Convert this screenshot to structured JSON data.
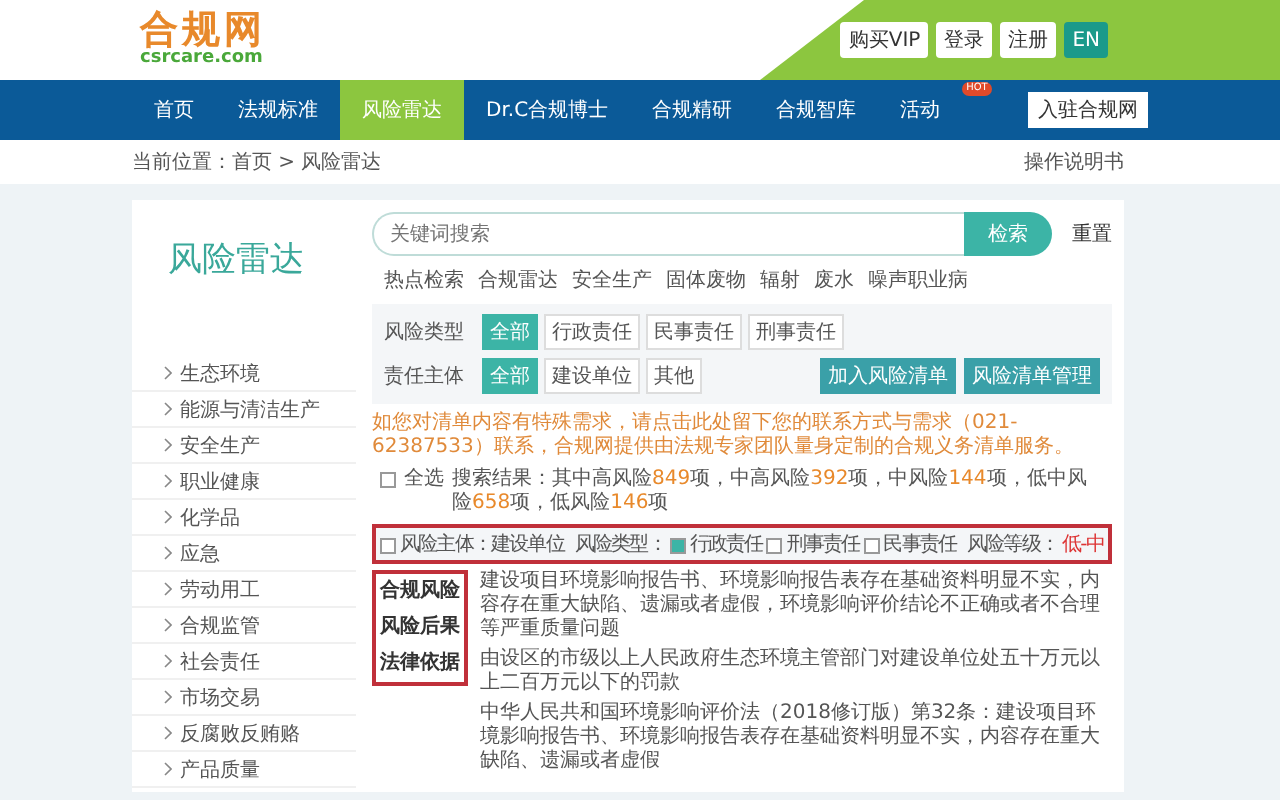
{
  "header": {
    "logo_text": "合规网",
    "logo_domain": "csrcare.com",
    "account_buttons": [
      {
        "label": "购买VIP",
        "kind": "plain"
      },
      {
        "label": "登录",
        "kind": "plain"
      },
      {
        "label": "注册",
        "kind": "plain"
      },
      {
        "label": "EN",
        "kind": "accent"
      }
    ]
  },
  "nav": {
    "items": [
      {
        "label": "首页",
        "selected": false
      },
      {
        "label": "法规标准",
        "selected": false
      },
      {
        "label": "风险雷达",
        "selected": true
      },
      {
        "label": "Dr.C合规博士",
        "selected": false
      },
      {
        "label": "合规精研",
        "selected": false
      },
      {
        "label": "合规智库",
        "selected": false
      },
      {
        "label": "活动",
        "selected": false,
        "badge": "HOT"
      }
    ],
    "join_button": "入驻合规网"
  },
  "breadcrumb": {
    "text": "当前位置：首页 > 风险雷达",
    "help_link": "操作说明书"
  },
  "page_title": "风险雷达",
  "search": {
    "placeholder": "关键词搜索",
    "submit": "检索",
    "reset": "重置",
    "hot_label": "热点检索",
    "hot_tags": [
      "合规雷达",
      "安全生产",
      "固体废物",
      "辐射",
      "废水",
      "噪声职业病"
    ]
  },
  "sidebar": {
    "items": [
      "生态环境",
      "能源与清洁生产",
      "安全生产",
      "职业健康",
      "化学品",
      "应急",
      "劳动用工",
      "合规监管",
      "社会责任",
      "市场交易",
      "反腐败反贿赂",
      "产品质量"
    ]
  },
  "filters": [
    {
      "label": "风险类型",
      "options": [
        {
          "label": "全部",
          "selected": true
        },
        {
          "label": "行政责任",
          "selected": false
        },
        {
          "label": "民事责任",
          "selected": false
        },
        {
          "label": "刑事责任",
          "selected": false
        }
      ]
    },
    {
      "label": "责任主体",
      "options": [
        {
          "label": "全部",
          "selected": true
        },
        {
          "label": "建设单位",
          "selected": false
        },
        {
          "label": "其他",
          "selected": false
        }
      ]
    }
  ],
  "list_buttons": [
    "加入风险清单",
    "风险清单管理"
  ],
  "notice": "如您对清单内容有特殊需求，请点击此处留下您的联系方式与需求（021-62387533）联系，合规网提供由法规专家团队量身定制的合规义务清单服务。",
  "results": {
    "select_all": {
      "label": "全选",
      "checked": false
    },
    "summary": "搜索结果：其中高风险**849**项，中高风险**392**项，中风险**144**项，低中风险**658**项，低风险**146**项"
  },
  "record": {
    "checked": false,
    "subject": "风险主体：建设单位",
    "type_label": "风险类型：",
    "types": [
      {
        "label": "行政责任",
        "checked": true
      },
      {
        "label": "刑事责任",
        "checked": false
      },
      {
        "label": "民事责任",
        "checked": false
      }
    ],
    "level_label": "风险等级：",
    "level_value": "低-中",
    "details": [
      {
        "label": "合规风险",
        "text": "建设项目环境影响报告书、环境影响报告表存在基础资料明显不实，内容存在重大缺陷、遗漏或者虚假，环境影响评价结论不正确或者不合理等严重质量问题"
      },
      {
        "label": "风险后果",
        "text": "由设区的市级以上人民政府生态环境主管部门对建设单位处五十万元以上二百万元以下的罚款"
      },
      {
        "label": "法律依据",
        "text": "中华人民共和国环境影响评价法（2018修订版）第32条：建设项目环境影响报告书、环境影响报告表存在基础资料明显不实，内容存在重大缺陷、遗漏或者虚假"
      }
    ]
  }
}
